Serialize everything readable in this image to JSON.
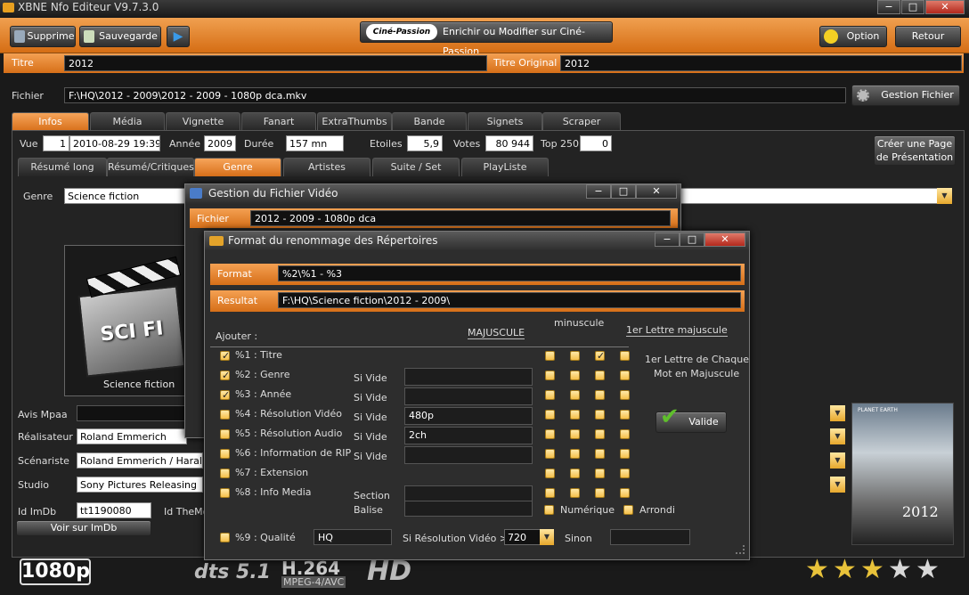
{
  "window": {
    "title": "XBNE Nfo Editeur V9.7.3.0",
    "min": "−",
    "max": "□",
    "close": "✕"
  },
  "toolbar": {
    "delete_label": "Supprime",
    "save_label": "Sauvegarde",
    "cine_logo": "Ciné-Passion",
    "cine_label": "Enrichir ou Modifier sur Ciné-Passion",
    "option_label": "Option",
    "back_label": "Retour"
  },
  "movie": {
    "titre_label": "Titre",
    "titre": "2012",
    "titre_orig_label": "Titre Original",
    "titre_orig": "2012",
    "fichier_label": "Fichier",
    "fichier": "F:\\HQ\\2012 - 2009\\2012 - 2009 - 1080p dca.mkv",
    "gestion_label": "Gestion Fichier"
  },
  "tabs": [
    "Infos",
    "Média",
    "Vignette",
    "Fanart",
    "ExtraThumbs",
    "Bande Annonce",
    "Signets",
    "Scraper"
  ],
  "info": {
    "vue_label": "Vue",
    "vue": "1",
    "date": "2010-08-29 19:39",
    "annee_label": "Année",
    "annee": "2009",
    "duree_label": "Durée",
    "duree": "157 mn",
    "etoiles_label": "Etoiles",
    "etoiles": "5,9",
    "votes_label": "Votes",
    "votes": "80 944",
    "top_label": "Top 250",
    "top": "0",
    "creer_label_1": "Créer une Page",
    "creer_label_2": "de Présentation"
  },
  "subtabs": [
    "Résumé long",
    "Résumé/Critiques",
    "Genre",
    "Artistes",
    "Suite / Set",
    "PlayListe"
  ],
  "genre": {
    "label": "Genre",
    "value": "Science fiction",
    "caption": "Science fiction",
    "badge": "SCI FI"
  },
  "fields": {
    "avis_label": "Avis Mpaa",
    "avis": "",
    "real_label": "Réalisateur",
    "real": "Roland Emmerich",
    "scen_label": "Scénariste",
    "scen": "Roland Emmerich / Harald Kl",
    "studio_label": "Studio",
    "studio": "Sony Pictures Releasing",
    "imdb_label": "Id ImDb",
    "imdb": "tt1190080",
    "tmdb_label": "Id TheMo",
    "imdb_btn": "Voir sur ImDb"
  },
  "logos": {
    "res": "1080p",
    "audio": "dts 5.1",
    "codec": "H.264",
    "codec_sub": "MPEG-4/AVC",
    "hd": "HD"
  },
  "poster": {
    "top": "PLANET EARTH",
    "title": "2012"
  },
  "rating": {
    "value": 3,
    "max": 5
  },
  "dialog1": {
    "title": "Gestion du Fichier Vidéo",
    "fichier_label": "Fichier",
    "fichier": "2012 - 2009 - 1080p dca"
  },
  "dialog2": {
    "title": "Format du renommage des Répertoires",
    "format_label": "Format",
    "format": "%2\\%1 - %3",
    "resultat_label": "Resultat",
    "resultat": "F:\\HQ\\Science fiction\\2012 - 2009\\",
    "ajouter": "Ajouter :",
    "majuscule": "MAJUSCULE",
    "minuscule": "minuscule",
    "lettre": "1er Lettre majuscule",
    "lettre_chaque_1": "1er Lettre de Chaque",
    "lettre_chaque_2": "Mot en Majuscule",
    "valide": "Valide",
    "numerique": "Numérique",
    "arrondi": "Arrondi",
    "qualite_label": "%9 : Qualité",
    "qualite": "HQ",
    "si_res_label": "Si Résolution Vidéo >=",
    "si_res": "720",
    "sinon_label": "Sinon",
    "sinon": "",
    "items": [
      {
        "label": "%1 : Titre",
        "checked": true,
        "cols": [
          false,
          false,
          true,
          false
        ]
      },
      {
        "label": "%2 : Genre",
        "checked": true,
        "side": "Si Vide",
        "value": "",
        "cols": [
          false,
          false,
          false,
          false
        ]
      },
      {
        "label": "%3 : Année",
        "checked": true,
        "side": "Si Vide",
        "value": "",
        "cols": [
          false,
          false,
          false,
          false
        ]
      },
      {
        "label": "%4 : Résolution Vidéo",
        "checked": false,
        "side": "Si Vide",
        "value": "480p",
        "cols": [
          false,
          false,
          false,
          false
        ]
      },
      {
        "label": "%5 : Résolution Audio",
        "checked": false,
        "side": "Si Vide",
        "value": "2ch",
        "cols": [
          false,
          false,
          false,
          false
        ]
      },
      {
        "label": "%6 : Information de RIP",
        "checked": false,
        "side": "Si Vide",
        "value": "",
        "cols": [
          false,
          false,
          false,
          false
        ]
      },
      {
        "label": "%7 : Extension",
        "checked": false,
        "cols": [
          false,
          false,
          false,
          false
        ]
      },
      {
        "label": "%8 : Info Media",
        "checked": false,
        "side": "Section",
        "value": "",
        "cols": [
          false,
          false,
          false,
          false
        ]
      }
    ],
    "balise_label": "Balise",
    "balise": ""
  }
}
